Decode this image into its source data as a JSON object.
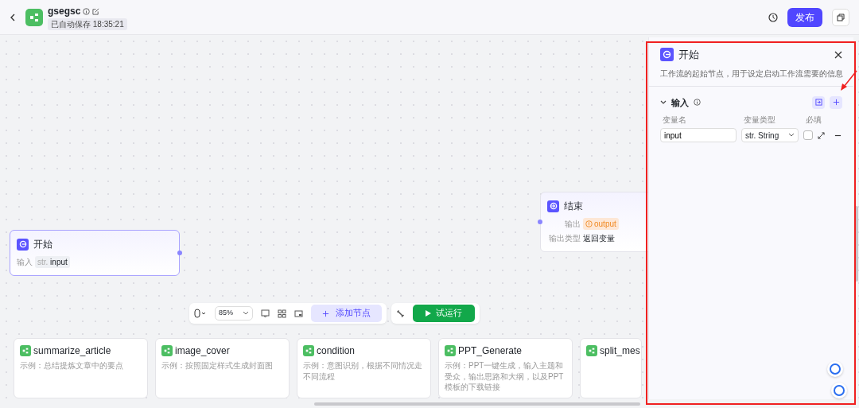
{
  "header": {
    "title": "gsegsc",
    "autosave": "已自动保存 18:35:21",
    "publish_button": "发布"
  },
  "nodes": [
    {
      "kind": "start",
      "title": "开始",
      "selected": true,
      "fields": [
        {
          "label": "输入",
          "type_prefix": "str.",
          "value": "input"
        }
      ]
    },
    {
      "kind": "end",
      "title": "结束",
      "selected": false,
      "fields": [
        {
          "label": "输出",
          "value": "output",
          "warning": true
        },
        {
          "label": "输出类型",
          "value": "返回变量",
          "warning": false
        }
      ]
    }
  ],
  "toolbar": {
    "zoom": "85%",
    "add_node": "添加节点",
    "run": "试运行"
  },
  "templates": [
    {
      "title": "summarize_article",
      "description": "示例：总结提炼文章中的要点"
    },
    {
      "title": "image_cover",
      "description": "示例：按照固定样式生成封面图"
    },
    {
      "title": "condition",
      "description": "示例：意图识别，根据不同情况走不同流程"
    },
    {
      "title": "PPT_Generate",
      "description": "示例：PPT一键生成，输入主题和受众，输出思路和大纲，以及PPT模板的下载链接"
    },
    {
      "title": "split_mes"
    }
  ],
  "panel": {
    "title": "开始",
    "description": "工作流的起始节点，用于设定启动工作流需要的信息",
    "section": {
      "title": "输入",
      "expanded": true,
      "columns": [
        "变量名",
        "变量类型",
        "必填"
      ],
      "variables": [
        {
          "name": "input",
          "type": "str. String",
          "required": false
        }
      ]
    }
  }
}
